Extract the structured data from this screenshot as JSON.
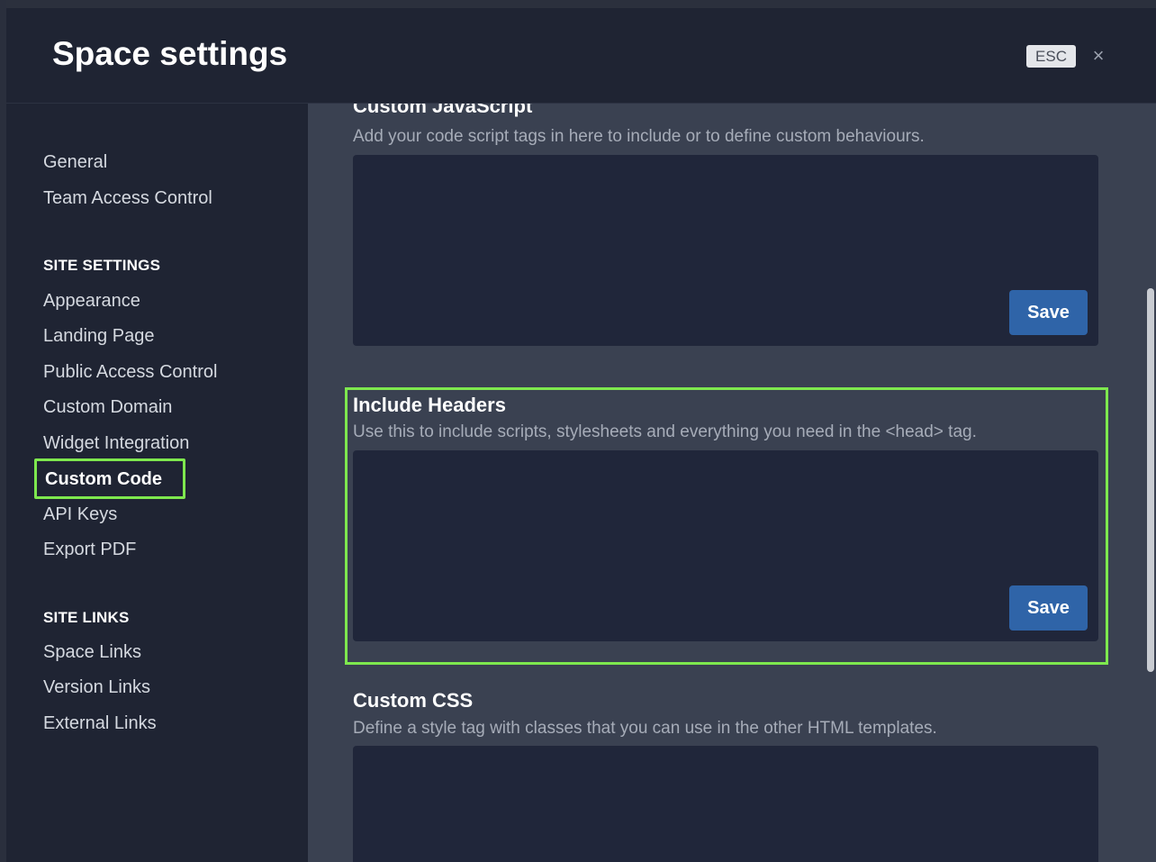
{
  "header": {
    "title": "Space settings",
    "esc_label": "ESC",
    "close_glyph": "×"
  },
  "sidebar": {
    "top_items": [
      {
        "label": "General"
      },
      {
        "label": "Team Access Control"
      }
    ],
    "site_settings": {
      "heading": "SITE SETTINGS",
      "items": [
        {
          "label": "Appearance"
        },
        {
          "label": "Landing Page"
        },
        {
          "label": "Public Access Control"
        },
        {
          "label": "Custom Domain"
        },
        {
          "label": "Widget Integration"
        },
        {
          "label": "Custom Code",
          "active": true
        },
        {
          "label": "API Keys"
        },
        {
          "label": "Export PDF"
        }
      ]
    },
    "site_links": {
      "heading": "SITE LINKS",
      "items": [
        {
          "label": "Space Links"
        },
        {
          "label": "Version Links"
        },
        {
          "label": "External Links"
        }
      ]
    }
  },
  "main": {
    "sections": [
      {
        "title": "Custom JavaScript",
        "description": "Add your code script tags in here to include or to define custom behaviours.",
        "save_label": "Save"
      },
      {
        "title": "Include Headers",
        "description": "Use this to include scripts, stylesheets and everything you need in the <head> tag.",
        "save_label": "Save"
      },
      {
        "title": "Custom CSS",
        "description": "Define a style tag with classes that you can use in the other HTML templates."
      }
    ]
  },
  "colors": {
    "highlight": "#7ee84e",
    "save_button": "#2f64a8",
    "panel_bg": "#3a4151",
    "sidebar_bg": "#1f2433"
  }
}
